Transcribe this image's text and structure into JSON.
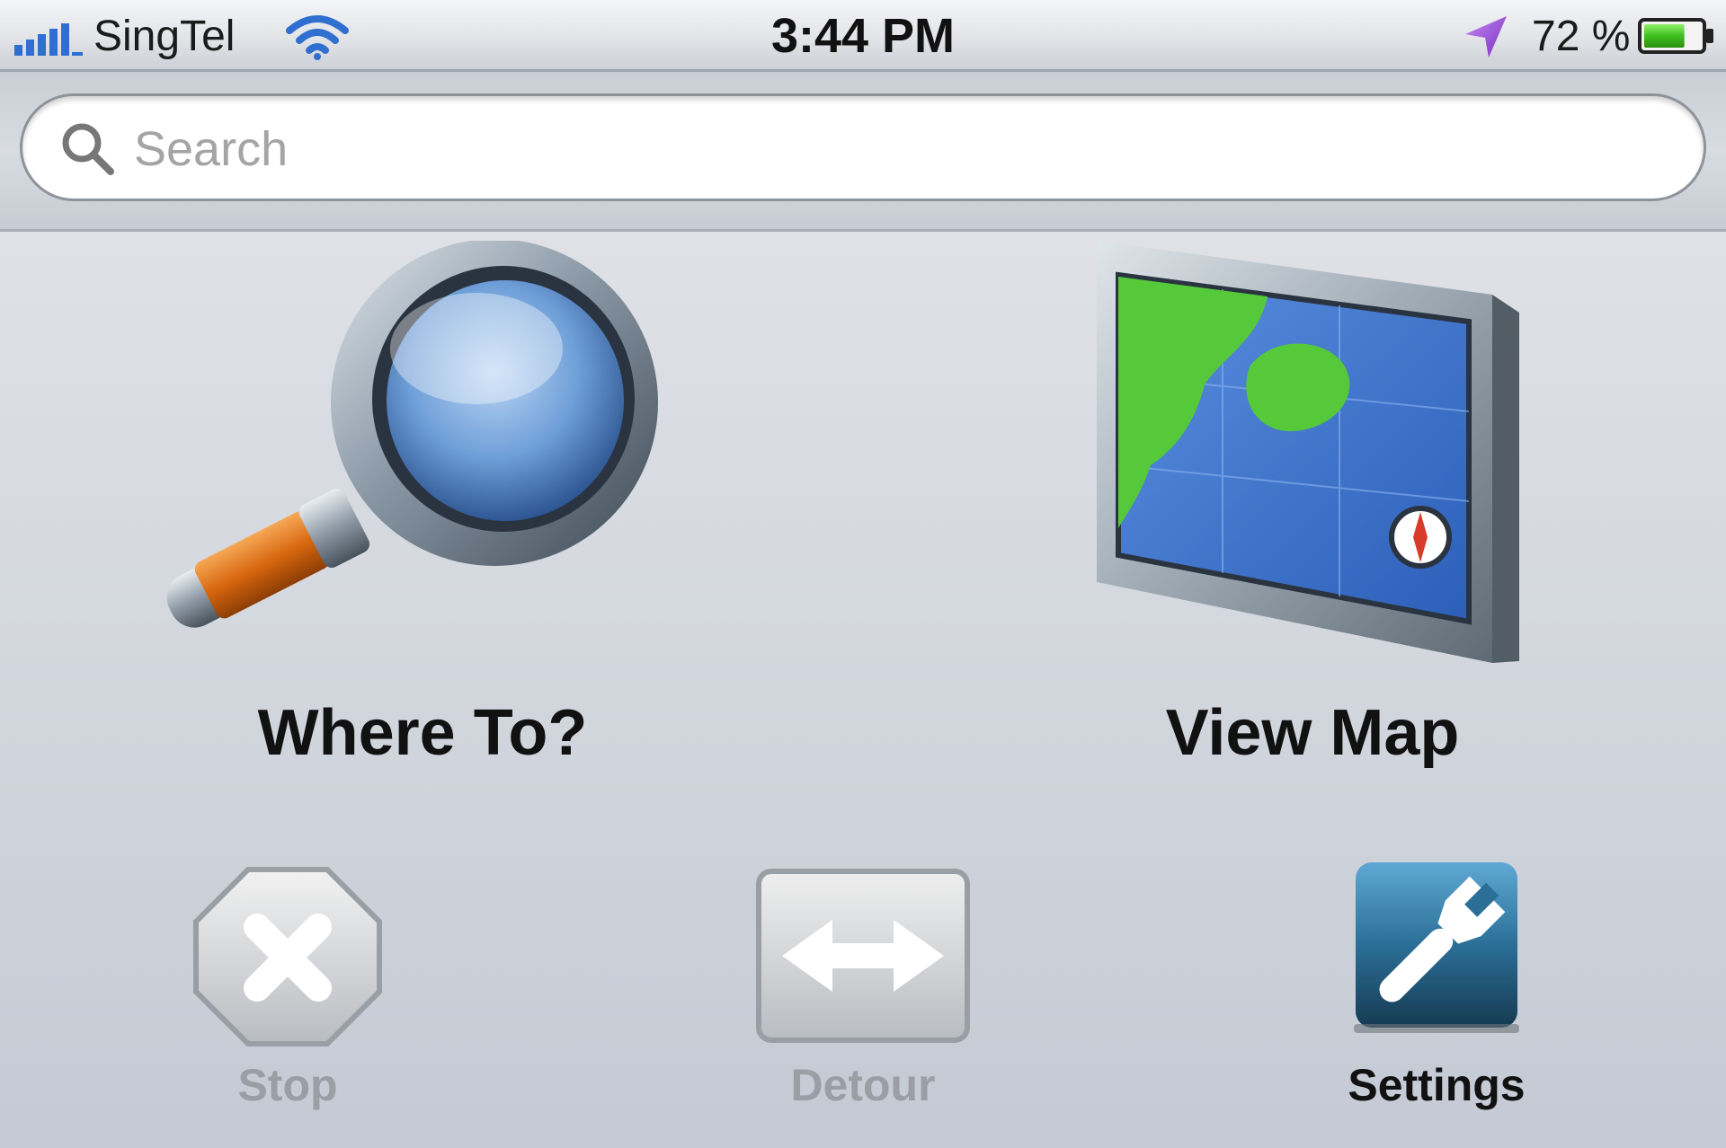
{
  "status_bar": {
    "carrier": "SingTel",
    "time": "3:44 PM",
    "battery_percent": "72 %",
    "battery_level": 0.72,
    "icons": [
      "signal-bars-icon",
      "wifi-icon",
      "location-arrow-icon",
      "battery-icon"
    ]
  },
  "search": {
    "placeholder": "Search",
    "value": "",
    "icon": "search-icon"
  },
  "main": {
    "where_to": {
      "label": "Where To?",
      "icon": "magnifying-glass-icon"
    },
    "view_map": {
      "label": "View Map",
      "icon": "map-screen-icon"
    }
  },
  "bottom": {
    "stop": {
      "label": "Stop",
      "icon": "stop-octagon-icon",
      "enabled": false
    },
    "detour": {
      "label": "Detour",
      "icon": "detour-arrows-icon",
      "enabled": false
    },
    "settings": {
      "label": "Settings",
      "icon": "wrench-icon",
      "enabled": true
    }
  },
  "colors": {
    "accent_settings": "#2b6f97",
    "location_arrow": "#9b3fd6",
    "battery_fill": "#3fbf1f",
    "signal": "#2f6fd0",
    "disabled_label": "#9a9ea5"
  }
}
